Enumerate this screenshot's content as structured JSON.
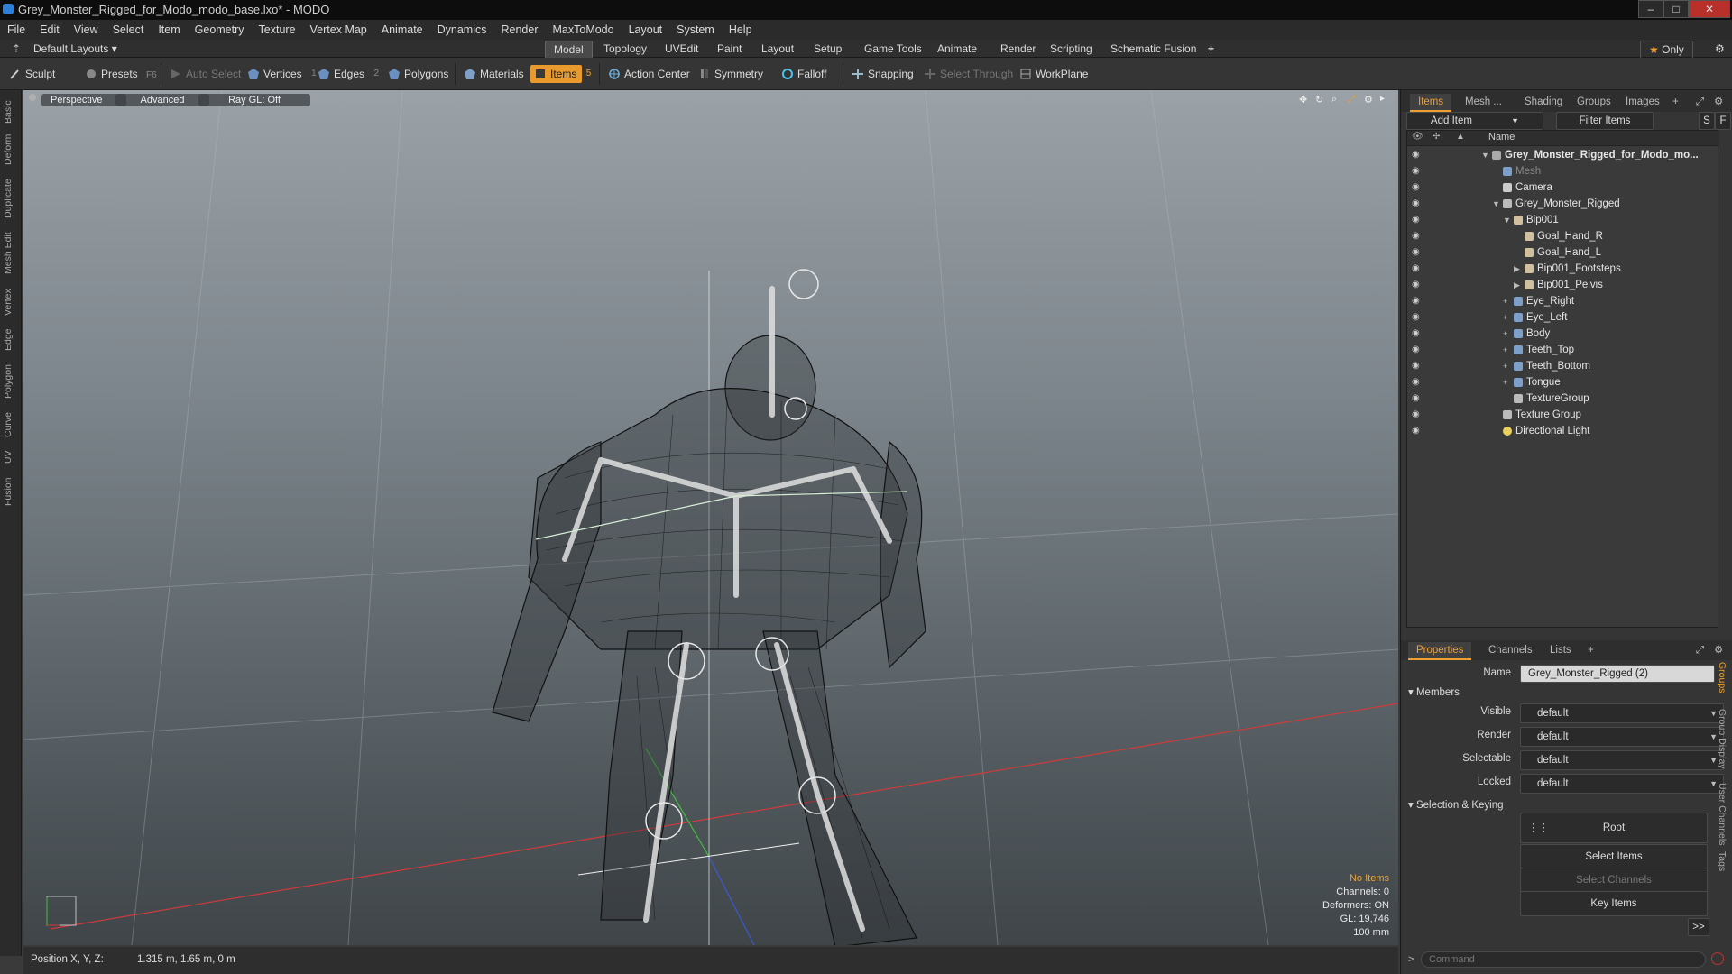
{
  "window": {
    "title": "Grey_Monster_Rigged_for_Modo_modo_base.lxo* - MODO",
    "minimize_glyph": "–",
    "maximize_glyph": "□",
    "close_glyph": "✕"
  },
  "menu": [
    "File",
    "Edit",
    "View",
    "Select",
    "Item",
    "Geometry",
    "Texture",
    "Vertex Map",
    "Animate",
    "Dynamics",
    "Render",
    "MaxToModo",
    "Layout",
    "System",
    "Help"
  ],
  "layout_bar": {
    "layouts_label": "Default Layouts",
    "tabs": [
      "Model",
      "Topology",
      "UVEdit",
      "Paint",
      "Layout",
      "Setup",
      "Game Tools",
      "Animate",
      "Render",
      "Scripting",
      "Schematic Fusion"
    ],
    "active_tab": "Model",
    "add_glyph": "+",
    "only_label": "Only",
    "star_glyph": "★",
    "gear_glyph": "⚙"
  },
  "toolbar": {
    "sculpt": "Sculpt",
    "presets": "Presets",
    "presets_key": "F6",
    "auto_select": "Auto Select",
    "vertices": "Vertices",
    "vertices_count": "1",
    "edges": "Edges",
    "edges_count": "2",
    "polygons": "Polygons",
    "materials": "Materials",
    "items": "Items",
    "items_count": "5",
    "action_center": "Action Center",
    "symmetry": "Symmetry",
    "falloff": "Falloff",
    "snapping": "Snapping",
    "select_through": "Select Through",
    "workplane": "WorkPlane"
  },
  "left_tabs": [
    "Basic",
    "Deform",
    "Duplicate",
    "Mesh Edit",
    "Vertex",
    "Edge",
    "Polygon",
    "Curve",
    "UV",
    "Fusion"
  ],
  "viewport": {
    "view_mode": "Perspective",
    "shading": "Advanced",
    "raygl": "Ray GL: Off",
    "stats": {
      "selection": "No Items",
      "channels": "Channels: 0",
      "deformers": "Deformers: ON",
      "gl": "GL: 19,746",
      "scale": "100 mm"
    },
    "colors": {
      "x_axis": "#d23a3a",
      "y_axis": "#3fbf3f",
      "z_axis": "#3a5ad2",
      "wire": "#111111",
      "bone": "#e0e0e0"
    }
  },
  "statusbar": {
    "position_label": "Position X, Y, Z:",
    "position_value": "1.315 m, 1.65 m, 0 m"
  },
  "items_panel": {
    "tabs": [
      "Items",
      "Mesh ...",
      "Shading",
      "Groups",
      "Images"
    ],
    "active_tab": "Items",
    "add_item": "Add Item",
    "filter_items": "Filter Items",
    "s_btn": "S",
    "f_btn": "F",
    "column_name": "Name",
    "rows": [
      {
        "label": "Grey_Monster_Rigged_for_Modo_mo...",
        "indent": 0,
        "bold": true,
        "icon": "scene-icon",
        "expand": "▼"
      },
      {
        "label": "Mesh",
        "indent": 1,
        "dim": true,
        "icon": "mesh-icon",
        "expand": ""
      },
      {
        "label": "Camera",
        "indent": 1,
        "icon": "camera-icon",
        "expand": ""
      },
      {
        "label": "Grey_Monster_Rigged",
        "indent": 1,
        "icon": "group-icon",
        "expand": "▼"
      },
      {
        "label": "Bip001",
        "indent": 2,
        "icon": "bone-icon",
        "expand": "▼"
      },
      {
        "label": "Goal_Hand_R",
        "indent": 3,
        "icon": "bone-icon",
        "expand": ""
      },
      {
        "label": "Goal_Hand_L",
        "indent": 3,
        "icon": "bone-icon",
        "expand": ""
      },
      {
        "label": "Bip001_Footsteps",
        "indent": 3,
        "icon": "bone-icon",
        "expand": "▶"
      },
      {
        "label": "Bip001_Pelvis",
        "indent": 3,
        "icon": "bone-icon",
        "expand": "▶"
      },
      {
        "label": "Eye_Right",
        "indent": 2,
        "icon": "mesh-icon",
        "expand": "+"
      },
      {
        "label": "Eye_Left",
        "indent": 2,
        "icon": "mesh-icon",
        "expand": "+"
      },
      {
        "label": "Body",
        "indent": 2,
        "icon": "mesh-icon",
        "expand": "+"
      },
      {
        "label": "Teeth_Top",
        "indent": 2,
        "icon": "mesh-icon",
        "expand": "+"
      },
      {
        "label": "Teeth_Bottom",
        "indent": 2,
        "icon": "mesh-icon",
        "expand": "+"
      },
      {
        "label": "Tongue",
        "indent": 2,
        "icon": "mesh-icon",
        "expand": "+"
      },
      {
        "label": "TextureGroup",
        "indent": 2,
        "icon": "group-icon",
        "expand": ""
      },
      {
        "label": "Texture Group",
        "indent": 1,
        "icon": "group-icon",
        "expand": ""
      },
      {
        "label": "Directional Light",
        "indent": 1,
        "icon": "light-icon",
        "expand": ""
      }
    ]
  },
  "properties_panel": {
    "tabs": [
      "Properties",
      "Channels",
      "Lists"
    ],
    "active_tab": "Properties",
    "add_glyph": "+",
    "name_label": "Name",
    "name_value": "Grey_Monster_Rigged (2)",
    "members_section": "Members",
    "fields": [
      {
        "label": "Visible",
        "value": "default"
      },
      {
        "label": "Render",
        "value": "default"
      },
      {
        "label": "Selectable",
        "value": "default"
      },
      {
        "label": "Locked",
        "value": "default"
      }
    ],
    "selection_section": "Selection & Keying",
    "root_label": "Root",
    "select_items": "Select Items",
    "select_channels": "Select Channels",
    "key_items": "Key Items",
    "more_glyph": ">>",
    "side_tabs": [
      "Groups",
      "Group Display",
      "User Channels",
      "Tags"
    ]
  },
  "command": {
    "prompt": ">",
    "placeholder": "Command"
  }
}
